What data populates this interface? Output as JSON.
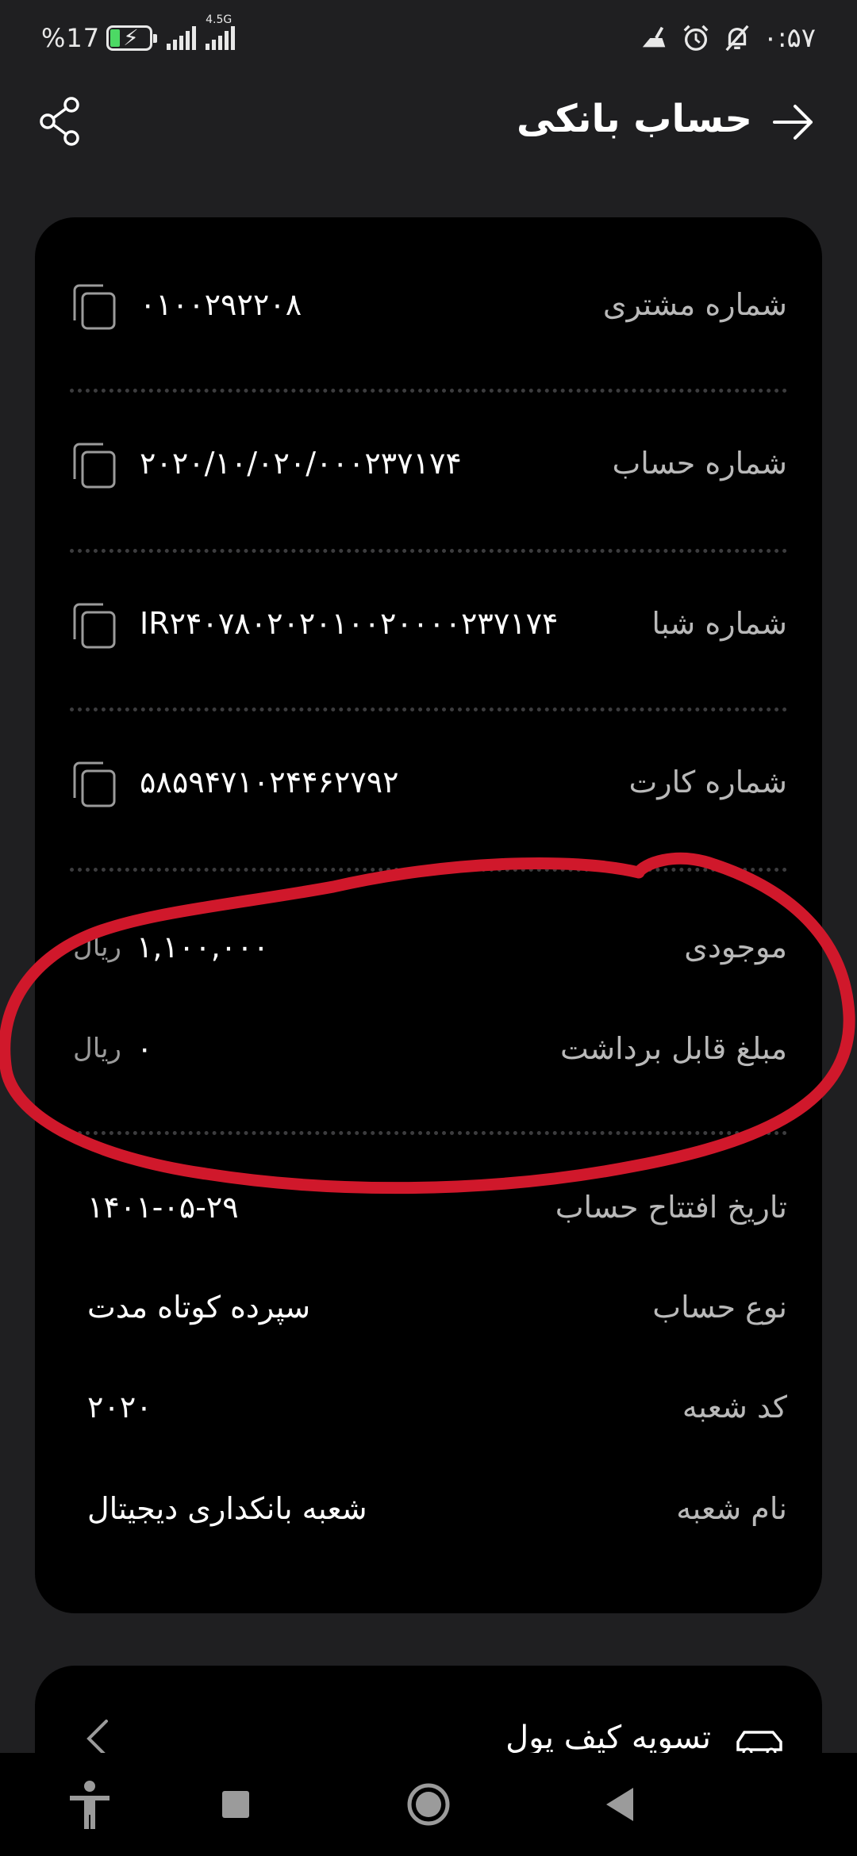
{
  "status_bar": {
    "battery_percent": "%17",
    "network": "4.5G",
    "time": "۰:۵۷"
  },
  "header": {
    "title": "حساب بانکی"
  },
  "account": {
    "customer_number": {
      "label": "شماره مشتری",
      "value": "۰۱۰۰۲۹۲۲۰۸"
    },
    "account_number": {
      "label": "شماره حساب",
      "value": "۲۰۲۰/۱۰/۰۲۰/۰۰۰۲۳۷۱۷۴"
    },
    "sheba_number": {
      "label": "شماره شبا",
      "value": "IR۲۴۰۷۸۰۲۰۲۰۱۰۰۲۰۰۰۰۲۳۷۱۷۴"
    },
    "card_number": {
      "label": "شماره کارت",
      "value": "۵۸۵۹۴۷۱۰۲۴۴۶۲۷۹۲"
    },
    "balance": {
      "label": "موجودی",
      "value": "۱,۱۰۰,۰۰۰",
      "currency": "ریال"
    },
    "withdrawable": {
      "label": "مبلغ قابل برداشت",
      "value": "۰",
      "currency": "ریال"
    },
    "opening_date": {
      "label": "تاریخ افتتاح حساب",
      "value": "۱۴۰۱-۰۵-۲۹"
    },
    "account_type": {
      "label": "نوع حساب",
      "value": "سپرده کوتاه مدت"
    },
    "branch_code": {
      "label": "کد شعبه",
      "value": "۲۰۲۰"
    },
    "branch_name": {
      "label": "نام شعبه",
      "value": "شعبه بانکداری دیجیتال"
    }
  },
  "secondary_card": {
    "label": "تسویه کیف پول"
  },
  "colors": {
    "background": "#1f1f21",
    "card": "#000000",
    "label": "#b9b9b9",
    "annotation": "#d0182b"
  }
}
